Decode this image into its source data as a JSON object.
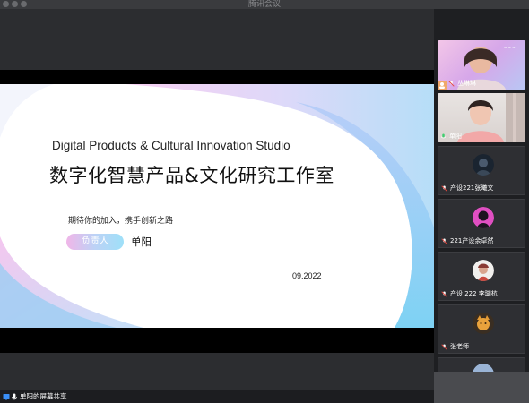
{
  "window": {
    "title": "腾讯会议"
  },
  "slide": {
    "title_en": "Digital Products & Cultural Innovation Studio",
    "title_cn": "数字化智慧产品&文化研究工作室",
    "tagline": "期待你的加入，携手创新之路",
    "role_badge": "负责人",
    "person": "单阳",
    "date": "09.2022"
  },
  "share_bar": {
    "label": "单阳的屏幕共享"
  },
  "participants": [
    {
      "name": "丛琳琳",
      "video": true,
      "accent": "#f0a86b"
    },
    {
      "name": "单阳",
      "video": true,
      "mic": "active"
    },
    {
      "name": "产设221张曦文",
      "avatar": "dark-person-icon"
    },
    {
      "name": "221产设余卓然",
      "avatar": "pink-figure-icon"
    },
    {
      "name": "产设 222 李瑚杭",
      "avatar": "sketch-avatar-icon"
    },
    {
      "name": "张老师",
      "avatar": "orange-cat-icon"
    }
  ],
  "colors": {
    "accent_blue": "#9fd7f3",
    "accent_pink": "#f0b6e8",
    "mic_muted": "#e5483f",
    "mic_active": "#3fcf6e"
  }
}
